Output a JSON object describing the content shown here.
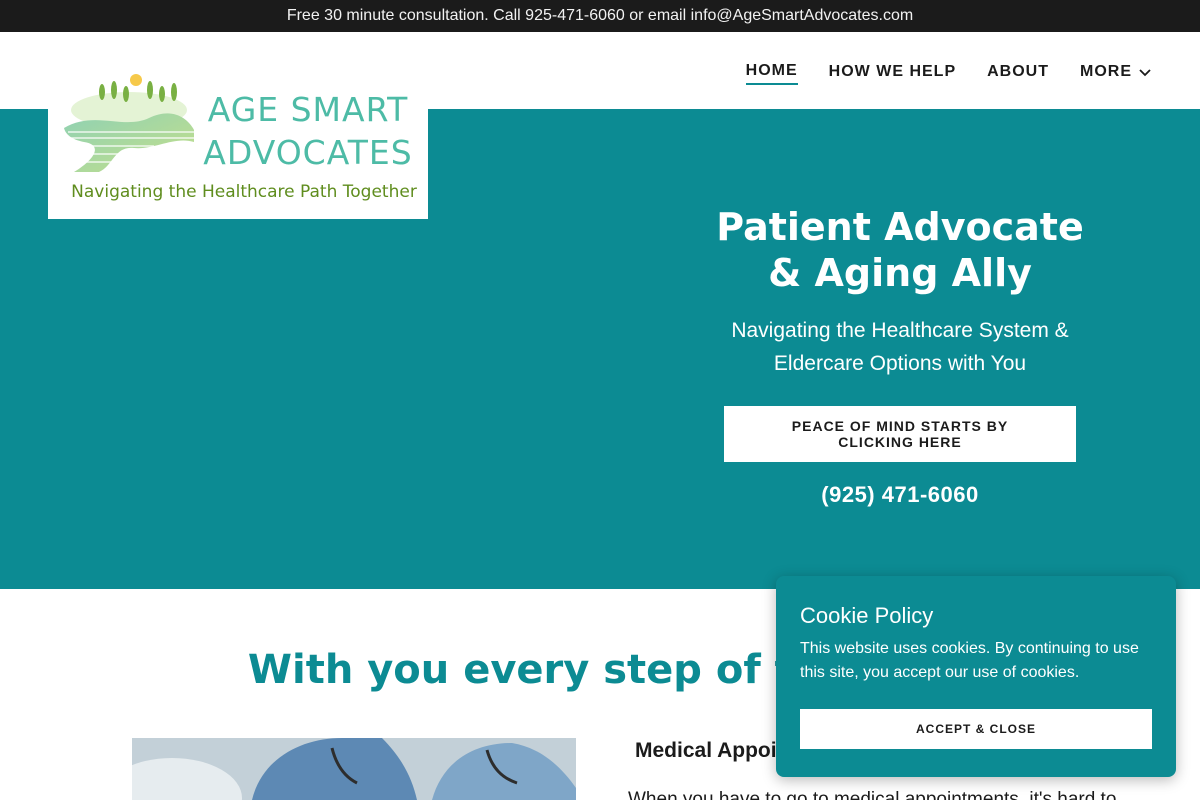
{
  "announcement": {
    "text": "Free 30 minute consultation. Call 925-471-6060 or email info@AgeSmartAdvocates.com"
  },
  "nav": {
    "items": [
      {
        "label": "HOME",
        "active": true
      },
      {
        "label": "HOW WE HELP"
      },
      {
        "label": "ABOUT"
      },
      {
        "label": "MORE",
        "icon": "chevron-down-icon"
      }
    ]
  },
  "logo": {
    "name_line1": "AGE SMART",
    "name_line2": "ADVOCATES",
    "tagline": "Navigating the Healthcare Path Together"
  },
  "hero": {
    "title_line1": "Patient Advocate",
    "title_line2": "& Aging Ally",
    "subtitle_line1": "Navigating the Healthcare System &",
    "subtitle_line2": "Eldercare Options with You",
    "cta_label": "PEACE OF MIND STARTS BY CLICKING HERE",
    "phone": "(925) 471-6060"
  },
  "section": {
    "title": "With you every step of the way",
    "service_heading": "Medical Appointments",
    "service_text": "When you have to go to medical appointments, it's hard to"
  },
  "cookie": {
    "title": "Cookie Policy",
    "text": "This website uses cookies. By continuing to use this site, you accept our use of cookies.",
    "button_label": "ACCEPT & CLOSE"
  },
  "colors": {
    "brand_teal": "#0c8b93",
    "announce_bg": "#1b1b1b",
    "logo_teal": "#4dbba6",
    "logo_green": "#5f8d1e"
  }
}
